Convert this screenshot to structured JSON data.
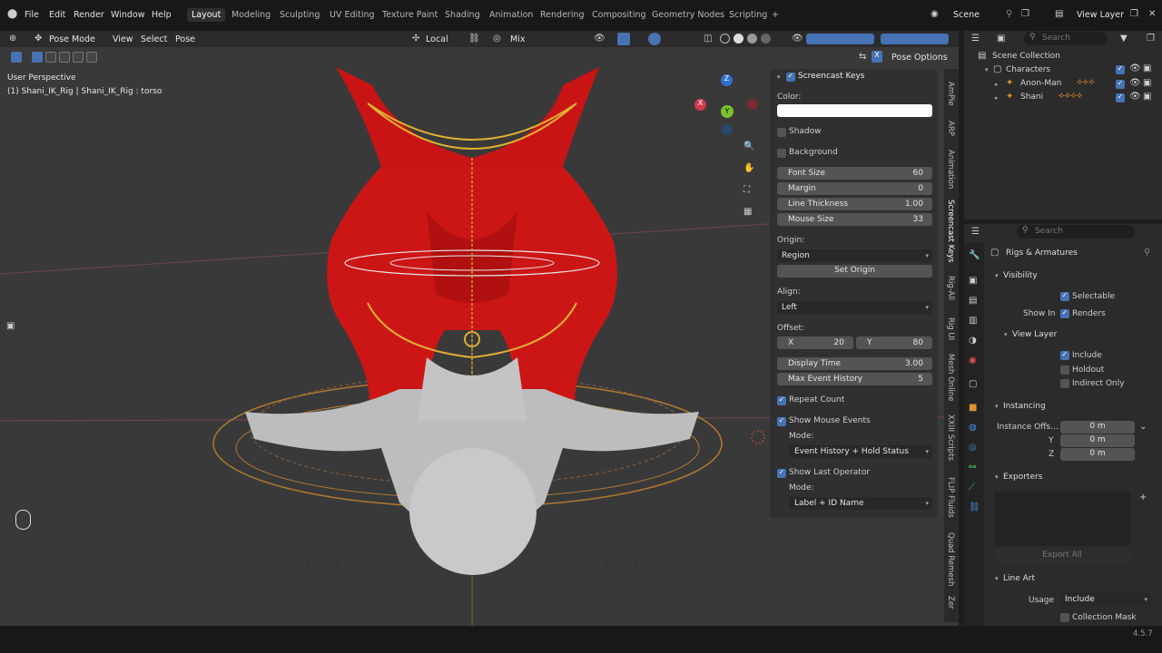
{
  "menu": {
    "file": "File",
    "edit": "Edit",
    "render": "Render",
    "window": "Window",
    "help": "Help"
  },
  "workspaces": [
    "Layout",
    "Modeling",
    "Sculpting",
    "UV Editing",
    "Texture Paint",
    "Shading",
    "Animation",
    "Rendering",
    "Compositing",
    "Geometry Nodes",
    "Scripting"
  ],
  "add_workspace": "+",
  "scene": "Scene",
  "view_layer": "View Layer",
  "viewport_header": {
    "mode": "Pose Mode",
    "view": "View",
    "select": "Select",
    "pose": "Pose",
    "orientation": "Local",
    "pivot": "Mix",
    "pose_options": "Pose Options",
    "close_x": "X"
  },
  "viewport_info": {
    "perspective": "User Perspective",
    "object": "(1) Shani_IK_Rig | Shani_IK_Rig : torso"
  },
  "gizmo": {
    "z": "Z",
    "y": "Y",
    "x": "X"
  },
  "screencast": {
    "title": "Screencast Keys",
    "color_label": "Color:",
    "shadow": "Shadow",
    "background": "Background",
    "font_size_label": "Font Size",
    "font_size": "60",
    "margin_label": "Margin",
    "margin": "0",
    "line_thickness_label": "Line Thickness",
    "line_thickness": "1.00",
    "mouse_size_label": "Mouse Size",
    "mouse_size": "33",
    "origin_label": "Origin:",
    "origin": "Region",
    "set_origin": "Set Origin",
    "align_label": "Align:",
    "align": "Left",
    "offset_label": "Offset:",
    "offset_x_label": "X",
    "offset_x": "20",
    "offset_y_label": "Y",
    "offset_y": "80",
    "display_time_label": "Display Time",
    "display_time": "3.00",
    "max_event_label": "Max Event History",
    "max_event": "5",
    "repeat_count": "Repeat Count",
    "show_mouse": "Show Mouse Events",
    "mode_label": "Mode:",
    "mouse_mode": "Event History + Hold Status",
    "show_last_op": "Show Last Operator",
    "mode2_label": "Mode:",
    "last_op_mode": "Label + ID Name"
  },
  "side_tabs": [
    "AmPie",
    "ARP",
    "Animation",
    "Screencast Keys",
    "Rig-All",
    "Rig UI",
    "Mesh Online",
    "XXIII Scripts",
    "FLIP Fluids",
    "Quad Remesh",
    "Zer"
  ],
  "outliner": {
    "search_placeholder": "Search",
    "root": "Scene Collection",
    "items": [
      "Characters",
      "Anon-Man",
      "Shani"
    ]
  },
  "properties": {
    "search_placeholder": "Search",
    "title": "Rigs & Armatures",
    "visibility": "Visibility",
    "selectable": "Selectable",
    "show_in": "Show In",
    "renders": "Renders",
    "view_layer": "View Layer",
    "include": "Include",
    "holdout": "Holdout",
    "indirect_only": "Indirect Only",
    "instancing": "Instancing",
    "instance_offset": "Instance Offs...",
    "x_val": "0 m",
    "y_label": "Y",
    "y_val": "0 m",
    "z_label": "Z",
    "z_val": "0 m",
    "exporters": "Exporters",
    "export_all": "Export All",
    "line_art": "Line Art",
    "usage_label": "Usage",
    "usage": "Include",
    "collection_mask": "Collection Mask"
  },
  "status": {
    "version": "4.5.7"
  }
}
